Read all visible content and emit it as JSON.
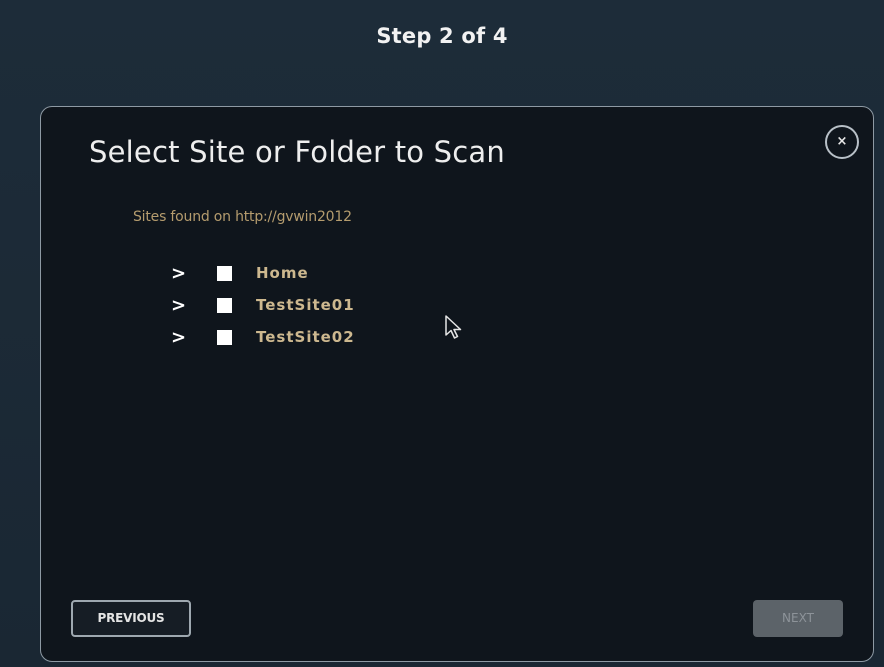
{
  "wizard": {
    "step_label": "Step 2 of 4"
  },
  "dialog": {
    "title": "Select Site or Folder to Scan",
    "close_label": "×",
    "sites_found_text": "Sites found on http://gvwin2012",
    "sites": [
      {
        "label": "Home",
        "expand_icon": ">",
        "checked": false
      },
      {
        "label": "TestSite01",
        "expand_icon": ">",
        "checked": false
      },
      {
        "label": "TestSite02",
        "expand_icon": ">",
        "checked": false
      }
    ],
    "previous_label": "PREVIOUS",
    "next_label": "NEXT",
    "next_enabled": false
  },
  "colors": {
    "background": "#1c2a36",
    "dialog_background": "#0f151c",
    "label_gold": "#cdb88f",
    "subtitle_gold": "#b59c6e",
    "disabled_button": "#5c6369"
  }
}
